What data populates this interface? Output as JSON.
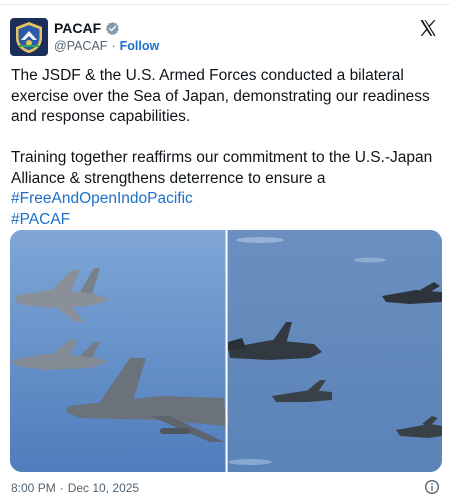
{
  "author": {
    "display_name": "PACAF",
    "handle": "@PACAF",
    "follow_label": "Follow",
    "separator": "·"
  },
  "tweet": {
    "paragraph1": "The JSDF & the U.S. Armed Forces conducted a bilateral exercise over the Sea of Japan, demonstrating our readiness and response capabilities.",
    "paragraph2": "Training together reaffirms our commitment to the U.S.-Japan Alliance & strengthens deterrence to ensure a",
    "hashtag1": "#FreeAndOpenIndoPacific",
    "hashtag2": "#PACAF"
  },
  "media": {
    "left_image": "aircraft-formation-photo-left",
    "right_image": "aircraft-formation-photo-right"
  },
  "footer": {
    "time": "8:00 PM",
    "separator": "·",
    "date": "Dec 10, 2025"
  },
  "icons": {
    "verified": "verified-badge-icon",
    "x_logo": "x-logo-icon",
    "info": "info-icon"
  },
  "colors": {
    "link": "#1d6fc9",
    "secondary_text": "#536471",
    "verified_badge": "#829aab"
  }
}
